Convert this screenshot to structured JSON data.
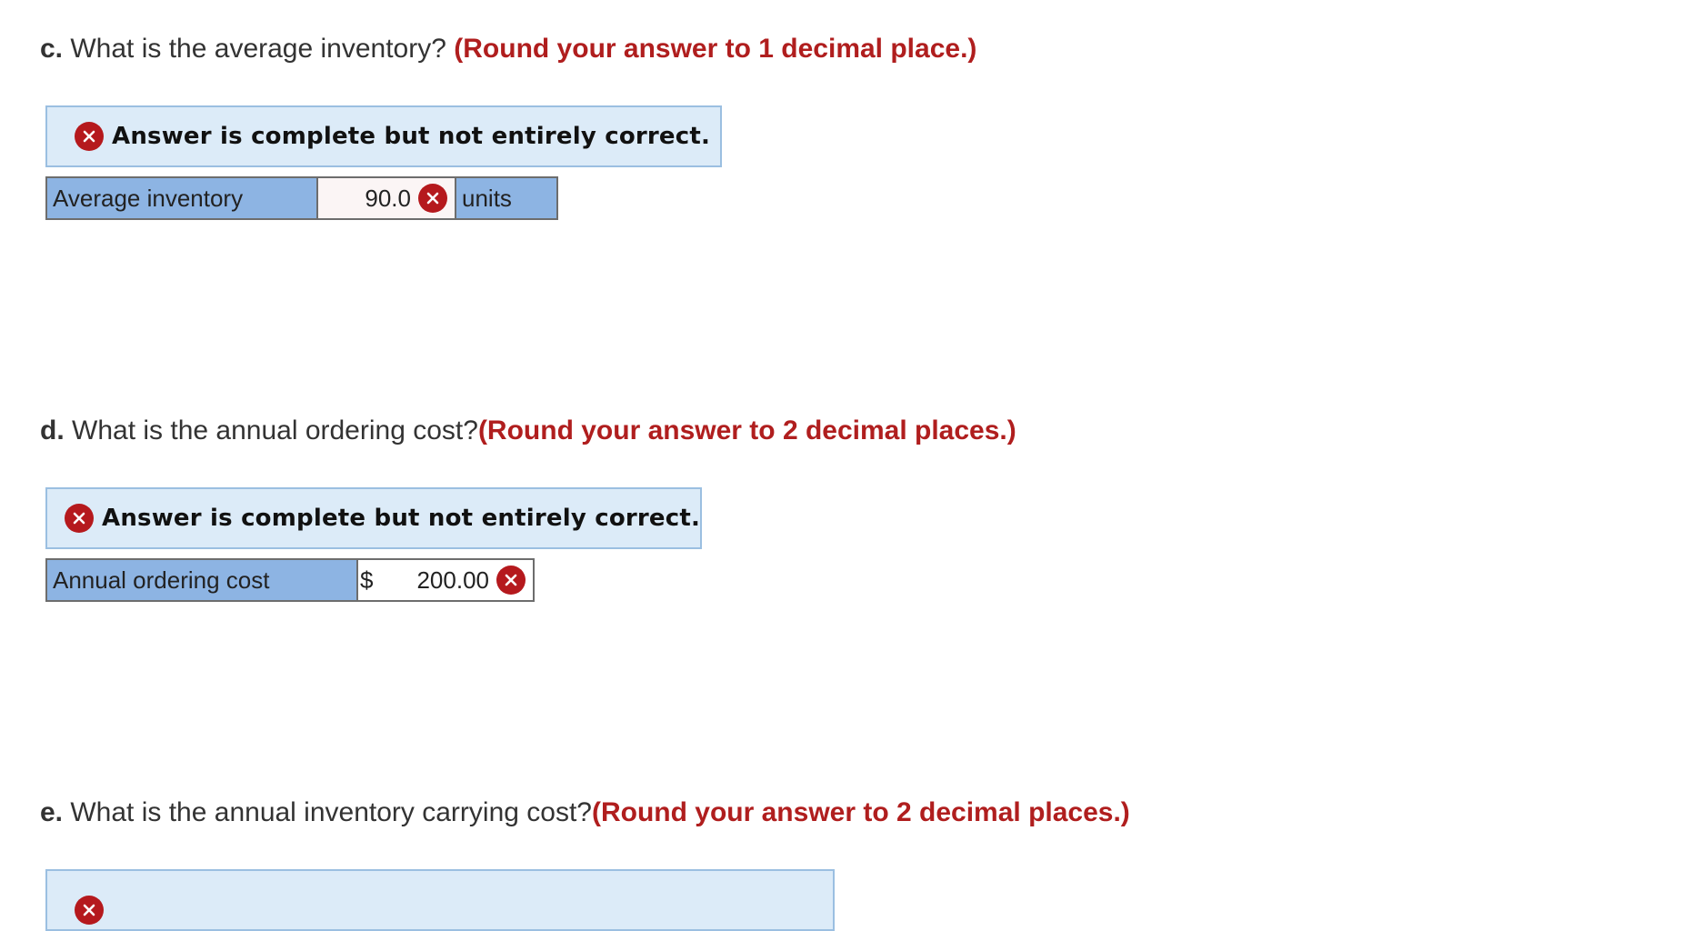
{
  "questions": {
    "c": {
      "letter": "c.",
      "text": " What is the average inventory? ",
      "hint": "(Round your answer to 1 decimal place.)",
      "banner": "Answer is complete but not entirely correct.",
      "row": {
        "label": "Average inventory",
        "value": "90.0",
        "units": "units"
      }
    },
    "d": {
      "letter": "d.",
      "text": " What is the annual ordering cost?",
      "hint": "(Round your answer to 2 decimal places.)",
      "banner": "Answer is complete but not entirely correct.",
      "row": {
        "label": "Annual ordering cost",
        "currency": "$",
        "value": "200.00"
      }
    },
    "e": {
      "letter": "e.",
      "text": " What is the annual inventory carrying cost?",
      "hint": "(Round your answer to 2 decimal places.)"
    }
  },
  "icons": {
    "incorrect": "x-circle-icon"
  },
  "colors": {
    "hint": "#b01e1e",
    "banner_bg": "#dcebf8",
    "banner_border": "#9bbfe1",
    "label_cell": "#8db4e3",
    "incorrect_icon": "#b5191d"
  }
}
